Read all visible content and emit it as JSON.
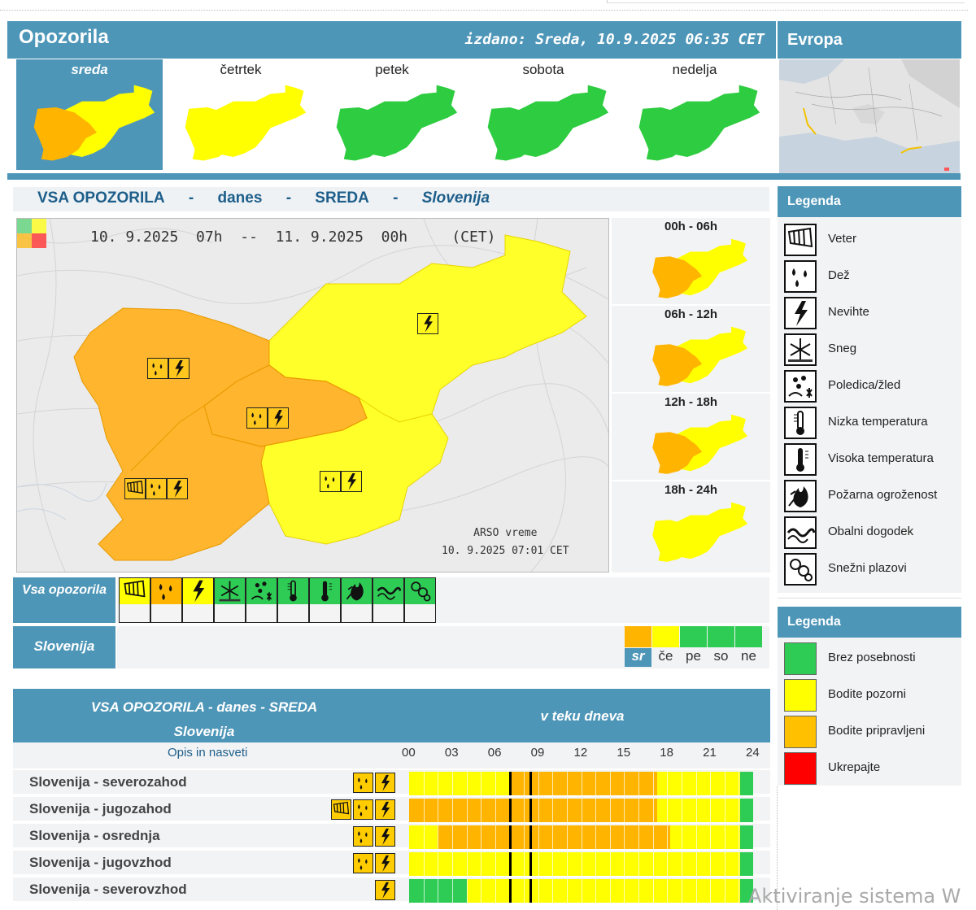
{
  "header": {
    "title": "Opozorila",
    "issued": "izdano: Sreda, 10.9.2025 06:35 CET",
    "europe": "Evropa"
  },
  "days": [
    {
      "label": "sreda",
      "active": true
    },
    {
      "label": "četrtek",
      "active": false
    },
    {
      "label": "petek",
      "active": false
    },
    {
      "label": "sobota",
      "active": false
    },
    {
      "label": "nedelja",
      "active": false
    }
  ],
  "title_row": {
    "part1": "VSA OPOZORILA",
    "sep": "-",
    "part2": "danes",
    "part3": "SREDA",
    "part4": "Slovenija"
  },
  "main_map": {
    "validity": "10. 9.2025  07h  --  11. 9.2025  00h     (CET)",
    "credit_line1": "ARSO vreme",
    "credit_line2": "10. 9.2025  07:01 CET"
  },
  "intervals": [
    "00h - 06h",
    "06h - 12h",
    "12h - 18h",
    "18h - 24h"
  ],
  "legend_icons": {
    "title": "Legenda",
    "items": [
      {
        "label": "Veter",
        "icon": "wind-icon"
      },
      {
        "label": "Dež",
        "icon": "rain-icon"
      },
      {
        "label": "Nevihte",
        "icon": "thunderstorm-icon"
      },
      {
        "label": "Sneg",
        "icon": "snow-icon"
      },
      {
        "label": "Poledica/žled",
        "icon": "ice-icon"
      },
      {
        "label": "Nizka temperatura",
        "icon": "low-temperature-icon"
      },
      {
        "label": "Visoka temperatura",
        "icon": "high-temperature-icon"
      },
      {
        "label": "Požarna ogroženost",
        "icon": "fire-icon"
      },
      {
        "label": "Obalni dogodek",
        "icon": "coastal-icon"
      },
      {
        "label": "Snežni plazovi",
        "icon": "avalanche-icon"
      }
    ]
  },
  "legend_levels": {
    "title": "Legenda",
    "items": [
      {
        "label": "Brez posebnosti",
        "color": "#2ecc55"
      },
      {
        "label": "Bodite pozorni",
        "color": "#ffff00"
      },
      {
        "label": "Bodite pripravljeni",
        "color": "#ffc000"
      },
      {
        "label": "Ukrepajte",
        "color": "#ff0000"
      }
    ]
  },
  "vsa_label": "Vsa opozorila",
  "slovenija_label": "Slovenija",
  "mini_days": [
    {
      "label": "sr",
      "color": "#ffb400",
      "active": true
    },
    {
      "label": "če",
      "color": "#ffff00",
      "active": false
    },
    {
      "label": "pe",
      "color": "#2ecc55",
      "active": false
    },
    {
      "label": "so",
      "color": "#2ecc55",
      "active": false
    },
    {
      "label": "ne",
      "color": "#2ecc55",
      "active": false
    }
  ],
  "table": {
    "title_line1": "VSA OPOZORILA - danes - SREDA",
    "title_line2": "Slovenija",
    "right_title": "v teku dneva",
    "opis": "Opis in nasveti",
    "hours": [
      "00",
      "03",
      "06",
      "09",
      "12",
      "15",
      "18",
      "21",
      "24"
    ],
    "rows": [
      {
        "name": "Slovenija - severozahod",
        "icons": [
          "rain-icon",
          "thunderstorm-icon"
        ],
        "segments": [
          {
            "from": 0,
            "to": 19,
            "color": "#ffff00"
          },
          {
            "from": 19,
            "to": 17.5,
            "color": "#ffff00"
          }
        ]
      },
      {
        "name": "Slovenija - jugozahod",
        "icons": [
          "wind-icon",
          "rain-icon",
          "thunderstorm-icon"
        ],
        "segments": []
      },
      {
        "name": "Slovenija - osrednja",
        "icons": [
          "rain-icon",
          "thunderstorm-icon"
        ],
        "segments": []
      },
      {
        "name": "Slovenija - jugovzhod",
        "icons": [
          "rain-icon",
          "thunderstorm-icon"
        ],
        "segments": []
      },
      {
        "name": "Slovenija - severovzhod",
        "icons": [
          "thunderstorm-icon"
        ],
        "segments": []
      }
    ]
  },
  "watermark": "Aktiviranje sistema W"
}
